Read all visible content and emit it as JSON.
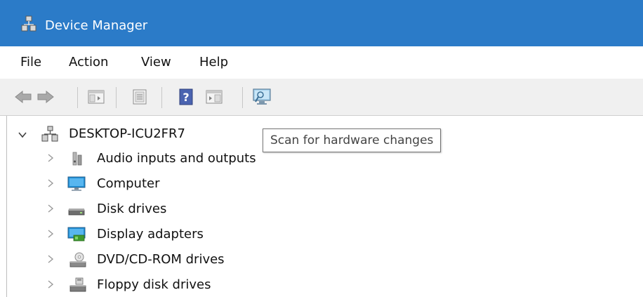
{
  "window": {
    "title": "Device Manager",
    "icon": "device-manager-icon",
    "titlebar_color": "#2b7bc8"
  },
  "menu": {
    "items": [
      "File",
      "Action",
      "View",
      "Help"
    ]
  },
  "toolbar": {
    "buttons": [
      {
        "name": "back-button",
        "icon": "arrow-left-icon"
      },
      {
        "name": "forward-button",
        "icon": "arrow-right-icon"
      },
      {
        "name": "show-hide-console-tree-button",
        "icon": "console-tree-icon"
      },
      {
        "name": "properties-button",
        "icon": "properties-icon"
      },
      {
        "name": "help-button",
        "icon": "help-icon"
      },
      {
        "name": "show-action-pane-button",
        "icon": "action-pane-icon"
      },
      {
        "name": "scan-hardware-button",
        "icon": "monitor-scan-icon"
      }
    ]
  },
  "tooltip": {
    "text": "Scan for hardware changes"
  },
  "tree": {
    "root": {
      "label": "DESKTOP-ICU2FR7",
      "icon": "computer-network-icon",
      "expanded": true
    },
    "items": [
      {
        "label": "Audio inputs and outputs",
        "icon": "speaker-icon"
      },
      {
        "label": "Computer",
        "icon": "monitor-icon"
      },
      {
        "label": "Disk drives",
        "icon": "disk-drive-icon"
      },
      {
        "label": "Display adapters",
        "icon": "display-adapter-icon"
      },
      {
        "label": "DVD/CD-ROM drives",
        "icon": "dvd-drive-icon"
      },
      {
        "label": "Floppy disk drives",
        "icon": "floppy-drive-icon"
      }
    ]
  }
}
